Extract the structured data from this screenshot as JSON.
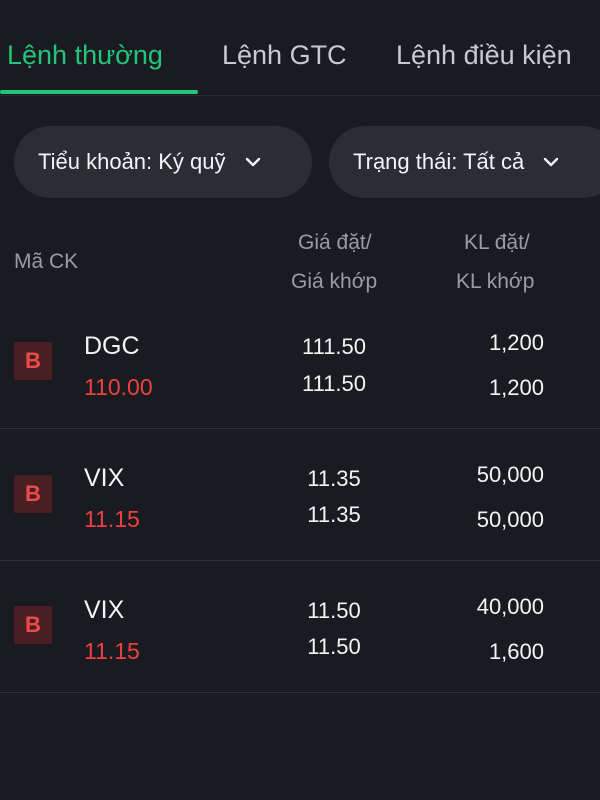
{
  "tabs": [
    {
      "label": "Lệnh thường",
      "active": true
    },
    {
      "label": "Lệnh GTC",
      "active": false
    },
    {
      "label": "Lệnh điều kiện",
      "active": false
    }
  ],
  "filters": {
    "account": {
      "label": "Tiểu khoản: Ký quỹ",
      "icon": "chevron-down-icon"
    },
    "status": {
      "label": "Trạng thái: Tất cả",
      "icon": "chevron-down-icon"
    }
  },
  "columns": {
    "symbol": "Mã CK",
    "price_line1": "Giá đặt/",
    "price_line2": "Giá khớp",
    "qty_line1": "KL đặt/",
    "qty_line2": "KL khớp"
  },
  "orders": [
    {
      "side": "B",
      "symbol": "DGC",
      "ref_price": "110.00",
      "order_price": "111.50",
      "matched_price": "111.50",
      "order_qty": "1,200",
      "matched_qty": "1,200"
    },
    {
      "side": "B",
      "symbol": "VIX",
      "ref_price": "11.15",
      "order_price": "11.35",
      "matched_price": "11.35",
      "order_qty": "50,000",
      "matched_qty": "50,000"
    },
    {
      "side": "B",
      "symbol": "VIX",
      "ref_price": "11.15",
      "order_price": "11.50",
      "matched_price": "11.50",
      "order_qty": "40,000",
      "matched_qty": "1,600"
    }
  ],
  "colors": {
    "accent": "#22c57a",
    "buy_badge_bg": "#4a1f23",
    "buy_text": "#ef4a4a",
    "background": "#1a1b21"
  }
}
